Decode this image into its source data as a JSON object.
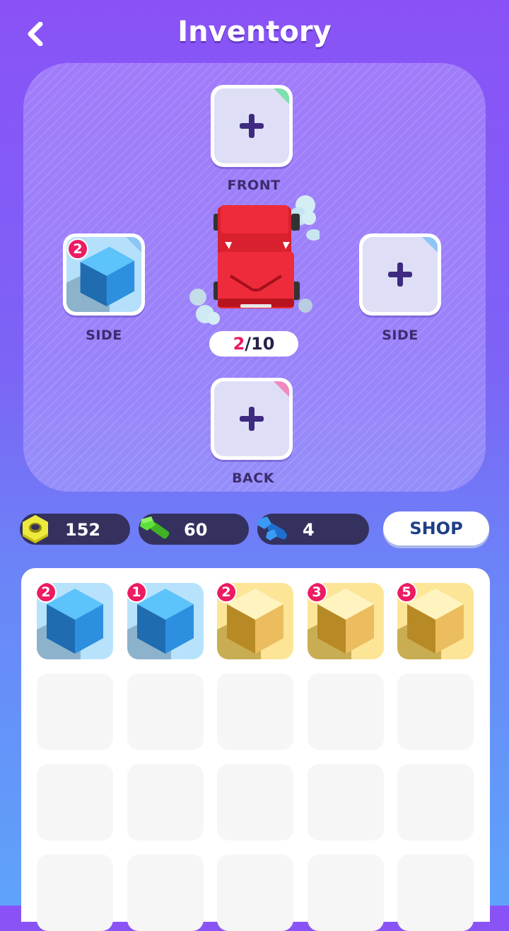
{
  "header": {
    "title": "Inventory",
    "back_icon": "chevron-left-icon"
  },
  "equipment": {
    "front": {
      "label": "FRONT",
      "corner_color": "#7fe0b0"
    },
    "left_side": {
      "label": "SIDE",
      "count": "2",
      "item": "blue-cube",
      "corner_color": "#8ec5f5"
    },
    "right_side": {
      "label": "SIDE",
      "corner_color": "#8ec5f5"
    },
    "back": {
      "label": "BACK",
      "corner_color": "#f08ac0"
    }
  },
  "vehicle": {
    "slots_used": "2",
    "slots_separator": "/",
    "slots_total": "10",
    "color": "#ee2b3b"
  },
  "resources": [
    {
      "icon": "nut-icon",
      "value": "152",
      "color": "#e8e030"
    },
    {
      "icon": "bolt-icon",
      "value": "60",
      "color": "#52d62e"
    },
    {
      "icon": "screws-icon",
      "value": "4",
      "color": "#2f8cf0"
    }
  ],
  "shop": {
    "label": "SHOP"
  },
  "inventory": [
    {
      "type": "blue",
      "count": "2"
    },
    {
      "type": "blue",
      "count": "1"
    },
    {
      "type": "gold",
      "count": "2"
    },
    {
      "type": "gold",
      "count": "3"
    },
    {
      "type": "gold",
      "count": "5"
    }
  ],
  "colors": {
    "badge": "#ec1b62",
    "accent_text": "#3b2d6e"
  }
}
